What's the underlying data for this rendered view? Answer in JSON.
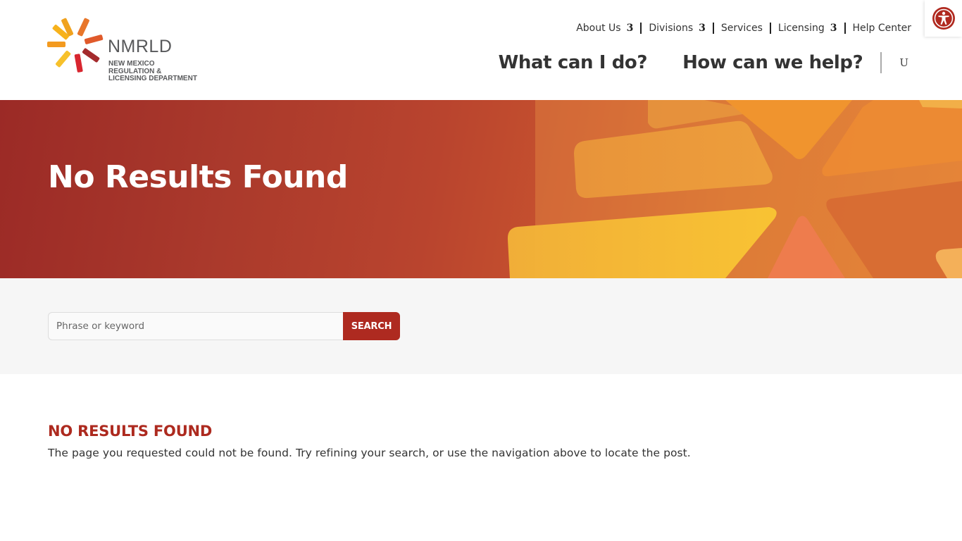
{
  "brand": {
    "wordmark": "NMRLD",
    "subtitle_lines": [
      "NEW MEXICO",
      "REGULATION &",
      "LICENSING DEPARTMENT"
    ],
    "colors": {
      "accent_red": "#ae2a20",
      "heading_red": "#ad2a1f",
      "text_dark": "#333333",
      "logo_gray": "#58595b"
    }
  },
  "top_nav": {
    "items": [
      {
        "label": "About Us",
        "has_dropdown": true,
        "dropdown_glyph": "3"
      },
      {
        "label": "Divisions",
        "has_dropdown": true,
        "dropdown_glyph": "3"
      },
      {
        "label": "Services",
        "has_dropdown": false
      },
      {
        "label": "Licensing",
        "has_dropdown": true,
        "dropdown_glyph": "3"
      },
      {
        "label": "Help Center",
        "has_dropdown": false
      }
    ]
  },
  "main_nav": {
    "items": [
      {
        "label": "What can I do?"
      },
      {
        "label": "How can we help?"
      }
    ],
    "search_glyph": "U"
  },
  "accessibility": {
    "icon": "accessibility-icon"
  },
  "hero": {
    "title": "No Results Found"
  },
  "search": {
    "placeholder": "Phrase or keyword",
    "value": "",
    "button_label": "SEARCH"
  },
  "content": {
    "heading": "NO RESULTS FOUND",
    "message": "The page you requested could not be found. Try refining your search, or use the navigation above to locate the post."
  }
}
